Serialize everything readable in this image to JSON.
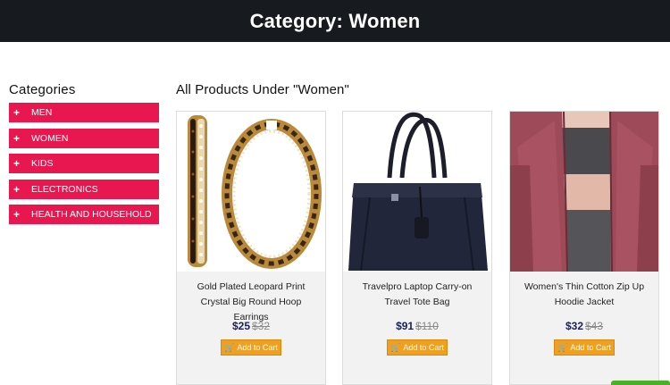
{
  "header": {
    "title": "Category: Women"
  },
  "sidebar": {
    "heading": "Categories",
    "items": [
      {
        "label": "MEN"
      },
      {
        "label": "WOMEN"
      },
      {
        "label": "KIDS"
      },
      {
        "label": "ELECTRONICS"
      },
      {
        "label": "HEALTH AND HOUSEHOLD"
      }
    ]
  },
  "main": {
    "title": "All Products Under \"Women\"",
    "products": [
      {
        "name": "Gold Plated Leopard Print Crystal Big Round Hoop Earrings",
        "price": "$25",
        "old_price": "$32",
        "button": "Add to Cart"
      },
      {
        "name": "Travelpro Laptop Carry-on Travel Tote Bag",
        "price": "$91",
        "old_price": "$110",
        "button": "Add to Cart"
      },
      {
        "name": "Women's Thin Cotton Zip Up Hoodie Jacket",
        "price": "$32",
        "old_price": "$43",
        "button": "Add to Cart"
      }
    ]
  },
  "colors": {
    "header_bg": "#171a1f",
    "category_bg": "#e8174f",
    "price": "#1a1f5c",
    "button": "#f0a020"
  }
}
